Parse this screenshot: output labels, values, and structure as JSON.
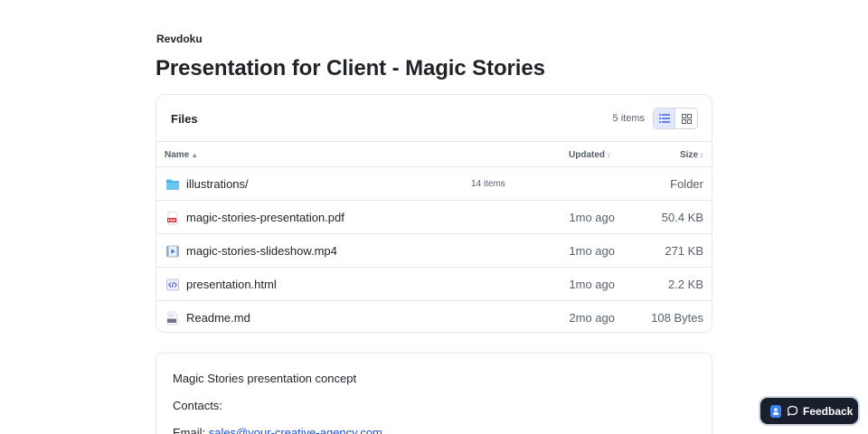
{
  "brand": "Revdoku",
  "title": "Presentation for Client - Magic Stories",
  "files_card": {
    "heading": "Files",
    "count": "5 items",
    "view_list_icon": "list-view-icon",
    "view_grid_icon": "grid-view-icon",
    "columns": {
      "name": "Name",
      "updated": "Updated",
      "size": "Size",
      "sort_asc": "▲",
      "sort_neutral": "↕"
    },
    "rows": [
      {
        "name": "illustrations/",
        "sub": "14 items",
        "updated": "",
        "size": "Folder",
        "icon": "folder-icon"
      },
      {
        "name": "magic-stories-presentation.pdf",
        "sub": "",
        "updated": "1mo ago",
        "size": "50.4 KB",
        "icon": "pdf-file-icon"
      },
      {
        "name": "magic-stories-slideshow.mp4",
        "sub": "",
        "updated": "1mo ago",
        "size": "271 KB",
        "icon": "video-file-icon"
      },
      {
        "name": "presentation.html",
        "sub": "",
        "updated": "1mo ago",
        "size": "2.2 KB",
        "icon": "code-file-icon"
      },
      {
        "name": "Readme.md",
        "sub": "",
        "updated": "2mo ago",
        "size": "108 Bytes",
        "icon": "markdown-file-icon"
      }
    ]
  },
  "readme": {
    "line1": "Magic Stories presentation concept",
    "line2": "Contacts:",
    "email_label": "Email: ",
    "email": "sales@your-creative-agency.com"
  },
  "feedback": {
    "label": "Feedback",
    "accent": "#3b82f6"
  }
}
